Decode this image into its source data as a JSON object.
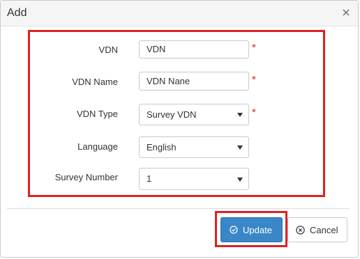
{
  "dialog": {
    "title": "Add",
    "close_icon": "close-icon"
  },
  "form": {
    "vdn": {
      "label": "VDN",
      "value": "VDN",
      "required": "*"
    },
    "vdn_name": {
      "label": "VDN Name",
      "value": "VDN Nane",
      "required": "*"
    },
    "vdn_type": {
      "label": "VDN Type",
      "value": "Survey VDN",
      "required": "*"
    },
    "language": {
      "label": "Language",
      "value": "English"
    },
    "survey_number": {
      "label": "Survey Number",
      "value": "1"
    }
  },
  "footer": {
    "update_label": "Update",
    "update_icon": "check-circle-icon",
    "cancel_label": "Cancel",
    "cancel_icon": "x-circle-icon"
  },
  "colors": {
    "highlight": "#e02020",
    "primary": "#3a87c8",
    "required": "#e02020"
  }
}
